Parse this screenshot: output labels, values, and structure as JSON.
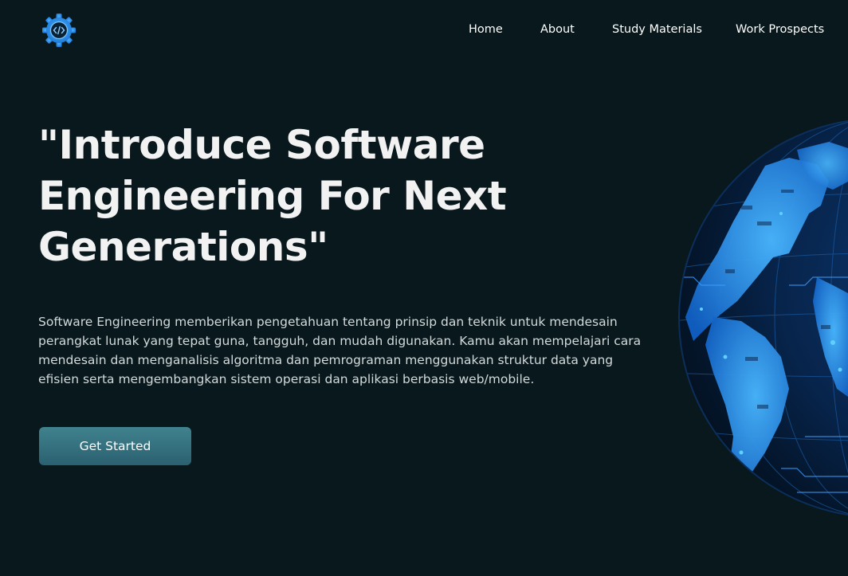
{
  "header": {
    "logo_icon": "gear-code-icon",
    "nav": {
      "home": "Home",
      "about": "About",
      "study_materials": "Study Materials",
      "work_prospects": "Work Prospects"
    }
  },
  "hero": {
    "title_line_1": "\"Introduce Software",
    "title_line_2": "Engineering For Next",
    "title_line_3": "Generations\"",
    "description": "Software Engineering memberikan pengetahuan tentang prinsip dan teknik untuk mendesain perangkat lunak yang tepat guna, tangguh, dan mudah digunakan. Kamu akan mempelajari cara mendesain dan menganalisis algoritma dan pemrograman menggunakan struktur data yang efisien serta mengembangkan sistem operasi dan aplikasi berbasis web/mobile.",
    "cta_label": "Get Started",
    "illustration": "digital-circuit-globe"
  },
  "colors": {
    "background": "#08181c",
    "accent": "#2a93e8",
    "button": "#3a7581",
    "text": "#ffffff"
  }
}
